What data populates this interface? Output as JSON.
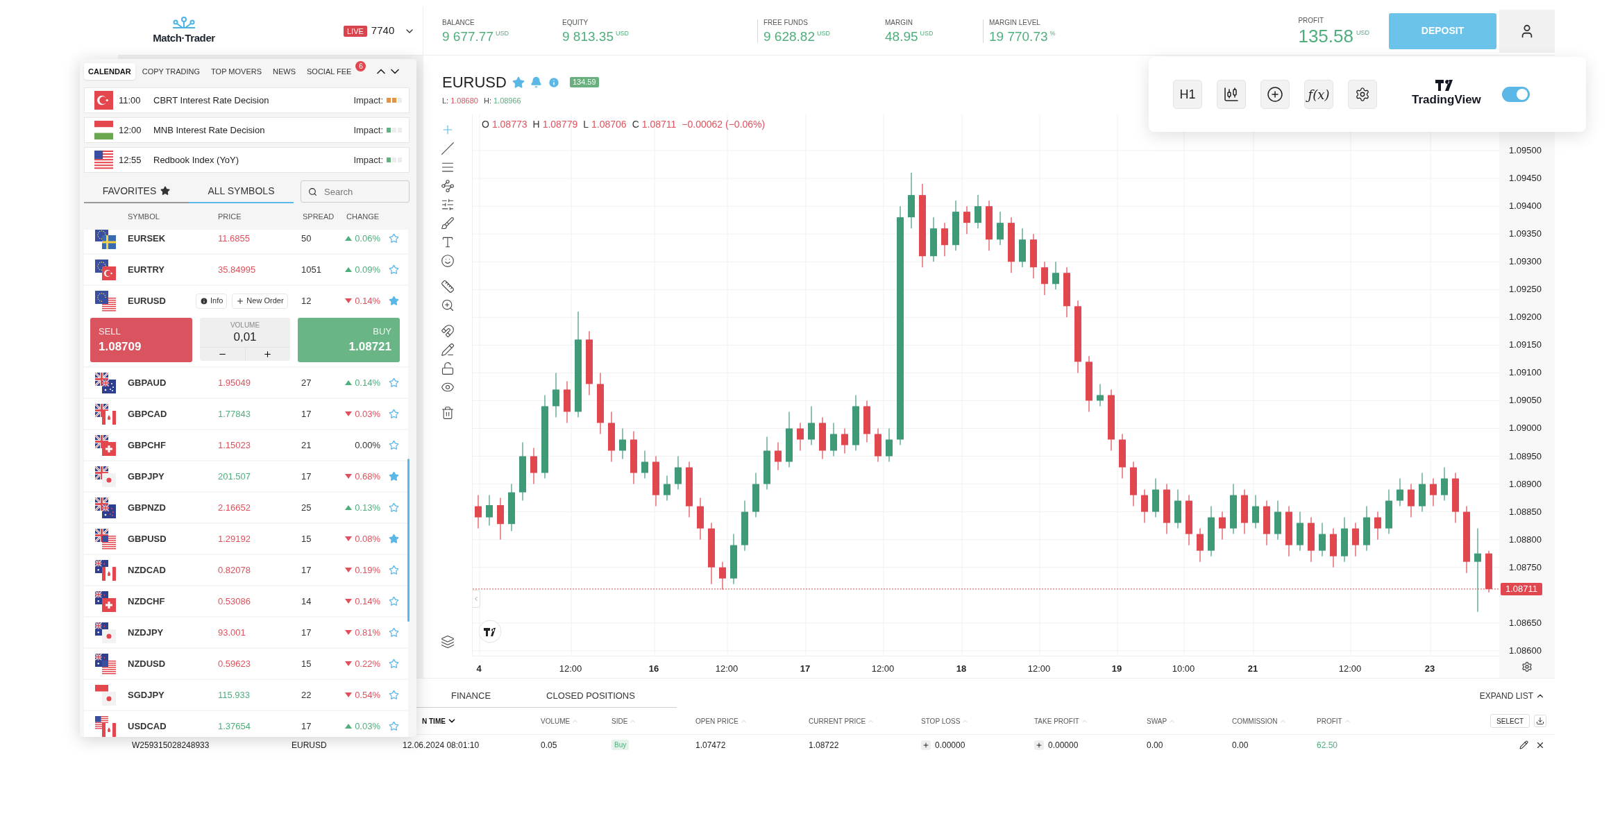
{
  "top_bar": {
    "logo_text": "Match·Trader",
    "account": {
      "badge": "LIVE",
      "number": "7740"
    },
    "stats": [
      {
        "label": "BALANCE",
        "value": "9 677.77",
        "unit": "USD"
      },
      {
        "label": "EQUITY",
        "value": "9 813.35",
        "unit": "USD"
      },
      {
        "label": "FREE FUNDS",
        "value": "9 628.82",
        "unit": "USD"
      },
      {
        "label": "MARGIN",
        "value": "48.95",
        "unit": "USD"
      },
      {
        "label": "MARGIN LEVEL",
        "value": "19 770.73",
        "unit": "%"
      }
    ],
    "profit": {
      "label": "PROFIT",
      "value": "135.58",
      "unit": "USD"
    },
    "deposit_button": "DEPOSIT"
  },
  "side_panel": {
    "tabs": [
      {
        "label": "CALENDAR",
        "selected": true
      },
      {
        "label": "COPY TRADING",
        "selected": false
      },
      {
        "label": "TOP MOVERS",
        "selected": false
      },
      {
        "label": "NEWS",
        "selected": false
      },
      {
        "label": "SOCIAL FEE",
        "selected": false,
        "badge": "6"
      }
    ],
    "events": [
      {
        "time": "11:00",
        "title": "CBRT Interest Rate Decision",
        "impact_label": "Impact:",
        "level": 0.67
      },
      {
        "time": "12:00",
        "title": "MNB Interest Rate Decision",
        "impact_label": "Impact:",
        "level": 0.33
      },
      {
        "time": "12:55",
        "title": "Redbook Index (YoY)",
        "impact_label": "Impact:",
        "level": 0.33
      }
    ],
    "symbol_tabs": [
      {
        "label": "FAVORITES",
        "selected": false
      },
      {
        "label": "ALL SYMBOLS",
        "selected": true
      }
    ],
    "search": {
      "placeholder": "Search"
    },
    "columns": [
      "SYMBOL",
      "PRICE",
      "SPREAD",
      "CHANGE"
    ],
    "rows": [
      {
        "symbol": "EURSEK",
        "price": "11.6855",
        "rising": false,
        "spread": "50",
        "change": "0.06%",
        "change_up": true,
        "change_down": false,
        "favorite": false,
        "expanded": false
      },
      {
        "symbol": "EURTRY",
        "price": "35.84995",
        "rising": false,
        "spread": "1051",
        "change": "0.09%",
        "change_up": true,
        "change_down": false,
        "favorite": false,
        "expanded": false
      },
      {
        "symbol": "EURUSD",
        "spread": "12",
        "change": "0.14%",
        "change_up": false,
        "change_down": true,
        "favorite": true,
        "expanded": true,
        "info_button": "Info",
        "new_order_button": "New Order",
        "order": {
          "sell_label": "SELL",
          "sell_price": "1.08709",
          "volume_label": "VOLUME",
          "volume": "0,01",
          "buy_label": "BUY",
          "buy_price": "1.08721"
        }
      },
      {
        "symbol": "GBPAUD",
        "price": "1.95049",
        "rising": false,
        "spread": "27",
        "change": "0.14%",
        "change_up": true,
        "change_down": false,
        "favorite": false,
        "expanded": false
      },
      {
        "symbol": "GBPCAD",
        "price": "1.77843",
        "rising": true,
        "spread": "17",
        "change": "0.03%",
        "change_up": false,
        "change_down": true,
        "favorite": false,
        "expanded": false
      },
      {
        "symbol": "GBPCHF",
        "price": "1.15023",
        "rising": false,
        "spread": "21",
        "change": "0.00%",
        "change_up": false,
        "change_down": false,
        "favorite": false,
        "expanded": false
      },
      {
        "symbol": "GBPJPY",
        "price": "201.507",
        "rising": true,
        "spread": "17",
        "change": "0.68%",
        "change_up": false,
        "change_down": true,
        "favorite": true,
        "expanded": false
      },
      {
        "symbol": "GBPNZD",
        "price": "2.16652",
        "rising": false,
        "spread": "25",
        "change": "0.13%",
        "change_up": true,
        "change_down": false,
        "favorite": false,
        "expanded": false
      },
      {
        "symbol": "GBPUSD",
        "price": "1.29192",
        "rising": false,
        "spread": "15",
        "change": "0.08%",
        "change_up": false,
        "change_down": true,
        "favorite": true,
        "expanded": false
      },
      {
        "symbol": "NZDCAD",
        "price": "0.82078",
        "rising": false,
        "spread": "17",
        "change": "0.19%",
        "change_up": false,
        "change_down": true,
        "favorite": false,
        "expanded": false
      },
      {
        "symbol": "NZDCHF",
        "price": "0.53086",
        "rising": false,
        "spread": "14",
        "change": "0.14%",
        "change_up": false,
        "change_down": true,
        "favorite": false,
        "expanded": false
      },
      {
        "symbol": "NZDJPY",
        "price": "93.001",
        "rising": false,
        "spread": "17",
        "change": "0.81%",
        "change_up": false,
        "change_down": true,
        "favorite": false,
        "expanded": false
      },
      {
        "symbol": "NZDUSD",
        "price": "0.59623",
        "rising": false,
        "spread": "15",
        "change": "0.22%",
        "change_up": false,
        "change_down": true,
        "favorite": false,
        "expanded": false
      },
      {
        "symbol": "SGDJPY",
        "price": "115.933",
        "rising": true,
        "spread": "22",
        "change": "0.54%",
        "change_up": false,
        "change_down": true,
        "favorite": false,
        "expanded": false
      },
      {
        "symbol": "USDCAD",
        "price": "1.37654",
        "rising": true,
        "spread": "17",
        "change": "0.03%",
        "change_up": true,
        "change_down": false,
        "favorite": false,
        "expanded": false
      }
    ]
  },
  "chart": {
    "symbol": "EURUSD",
    "badge": "134.59",
    "low_label": "L:",
    "low": "1.08680",
    "high_label": "H:",
    "high": "1.08966",
    "ohlc": [
      {
        "label": "O",
        "value": "1.08773"
      },
      {
        "label": "H",
        "value": "1.08779"
      },
      {
        "label": "L",
        "value": "1.08706"
      },
      {
        "label": "C",
        "value": "1.08711"
      }
    ],
    "change": "−0.00062 (−0.06%)",
    "chart_data": {
      "type": "candlestick",
      "grid": true,
      "ref_lines": [
        {
          "axis": "y",
          "value": 1.08711,
          "color": "#e0474f"
        }
      ],
      "ylim": [
        1.08591,
        1.09565
      ],
      "yticks": [
        {
          "value": 1.095,
          "label": "1.09500"
        },
        {
          "value": 1.0945,
          "label": "1.09450"
        },
        {
          "value": 1.094,
          "label": "1.09400"
        },
        {
          "value": 1.0935,
          "label": "1.09350"
        },
        {
          "value": 1.093,
          "label": "1.09300"
        },
        {
          "value": 1.0925,
          "label": "1.09250"
        },
        {
          "value": 1.092,
          "label": "1.09200"
        },
        {
          "value": 1.0915,
          "label": "1.09150"
        },
        {
          "value": 1.091,
          "label": "1.09100"
        },
        {
          "value": 1.0905,
          "label": "1.09050"
        },
        {
          "value": 1.09,
          "label": "1.09000"
        },
        {
          "value": 1.0895,
          "label": "1.08950"
        },
        {
          "value": 1.089,
          "label": "1.08900"
        },
        {
          "value": 1.0885,
          "label": "1.08850"
        },
        {
          "value": 1.088,
          "label": "1.08800"
        },
        {
          "value": 1.0875,
          "label": "1.08750"
        },
        {
          "value": 1.0865,
          "label": "1.08650"
        },
        {
          "value": 1.086,
          "label": "1.08600"
        }
      ],
      "categories": [
        null,
        null,
        null,
        null,
        null,
        null,
        null,
        null,
        null,
        null,
        null,
        null,
        null,
        null,
        null,
        null,
        null,
        null,
        null,
        null,
        null,
        null,
        null,
        null,
        null,
        null,
        null,
        null,
        null,
        null,
        null,
        null,
        null,
        null,
        null,
        null,
        null,
        null,
        null,
        null,
        null,
        null,
        null,
        null,
        null,
        null,
        null,
        null,
        null,
        null,
        null,
        null,
        null,
        null,
        null,
        null,
        null,
        null,
        null,
        null,
        null,
        null,
        null,
        null,
        null,
        null,
        null,
        null,
        null,
        null,
        null,
        null,
        null,
        null,
        null,
        null,
        null,
        null,
        null,
        null,
        null,
        null,
        null,
        null,
        null,
        null,
        null,
        null,
        null,
        null,
        null,
        null
      ],
      "ohlc": [
        [
          1.0886,
          1.0888,
          1.0882,
          1.0884
        ],
        [
          1.0884,
          1.0888,
          1.08825,
          1.08862
        ],
        [
          1.08862,
          1.08875,
          1.088,
          1.08828
        ],
        [
          1.08828,
          1.089,
          1.08815,
          1.08885
        ],
        [
          1.08885,
          1.08975,
          1.0887,
          1.0895
        ],
        [
          1.0895,
          1.08965,
          1.089,
          1.0892
        ],
        [
          1.0892,
          1.0906,
          1.0891,
          1.0904
        ],
        [
          1.0904,
          1.091,
          1.0902,
          1.0907
        ],
        [
          1.0907,
          1.09085,
          1.0901,
          1.0903
        ],
        [
          1.0903,
          1.0921,
          1.0902,
          1.0916
        ],
        [
          1.0916,
          1.09175,
          1.0906,
          1.0908
        ],
        [
          1.0908,
          1.091,
          1.0899,
          1.0901
        ],
        [
          1.0901,
          1.0903,
          1.0894,
          1.0896
        ],
        [
          1.0896,
          1.09,
          1.08945,
          1.0898
        ],
        [
          1.0898,
          1.08995,
          1.089,
          1.0892
        ],
        [
          1.0892,
          1.0896,
          1.0891,
          1.0894
        ],
        [
          1.0894,
          1.0895,
          1.0886,
          1.0888
        ],
        [
          1.0888,
          1.08915,
          1.0887,
          1.089
        ],
        [
          1.089,
          1.0895,
          1.0889,
          1.0893
        ],
        [
          1.0893,
          1.0894,
          1.0884,
          1.0886
        ],
        [
          1.0886,
          1.08875,
          1.088,
          1.0882
        ],
        [
          1.0882,
          1.0883,
          1.0872,
          1.0875
        ],
        [
          1.0875,
          1.0876,
          1.0871,
          1.0873
        ],
        [
          1.0873,
          1.0881,
          1.0872,
          1.0879
        ],
        [
          1.0879,
          1.0887,
          1.0878,
          1.0885
        ],
        [
          1.0885,
          1.0892,
          1.0884,
          1.089
        ],
        [
          1.089,
          1.08985,
          1.0889,
          1.0896
        ],
        [
          1.0896,
          1.08975,
          1.08925,
          1.0894
        ],
        [
          1.0894,
          1.0903,
          1.0893,
          1.09
        ],
        [
          1.09,
          1.0901,
          1.0896,
          1.0898
        ],
        [
          1.0898,
          1.0904,
          1.0897,
          1.0901
        ],
        [
          1.0901,
          1.0902,
          1.08945,
          1.0896
        ],
        [
          1.0896,
          1.0901,
          1.0895,
          1.0899
        ],
        [
          1.0899,
          1.09,
          1.08955,
          1.0897
        ],
        [
          1.0897,
          1.0906,
          1.0896,
          1.0904
        ],
        [
          1.0904,
          1.0905,
          1.08975,
          1.0899
        ],
        [
          1.0899,
          1.09,
          1.0894,
          1.0895
        ],
        [
          1.0895,
          1.09,
          1.0894,
          1.0898
        ],
        [
          1.0898,
          1.094,
          1.0897,
          1.0938
        ],
        [
          1.0938,
          1.0946,
          1.0936,
          1.0942
        ],
        [
          1.0942,
          1.0944,
          1.0929,
          1.0931
        ],
        [
          1.0931,
          1.0938,
          1.093,
          1.0936
        ],
        [
          1.0936,
          1.0937,
          1.0931,
          1.0933
        ],
        [
          1.0933,
          1.0941,
          1.0932,
          1.0939
        ],
        [
          1.0939,
          1.094,
          1.0935,
          1.0937
        ],
        [
          1.0937,
          1.0942,
          1.0936,
          1.094
        ],
        [
          1.094,
          1.0941,
          1.0932,
          1.0934
        ],
        [
          1.0934,
          1.0939,
          1.0933,
          1.0937
        ],
        [
          1.0937,
          1.0938,
          1.0928,
          1.093
        ],
        [
          1.093,
          1.0936,
          1.0929,
          1.0934
        ],
        [
          1.0934,
          1.0935,
          1.0927,
          1.0929
        ],
        [
          1.0929,
          1.093,
          1.0924,
          1.0926
        ],
        [
          1.0926,
          1.093,
          1.0925,
          1.0928
        ],
        [
          1.0928,
          1.0929,
          1.092,
          1.0922
        ],
        [
          1.0922,
          1.0923,
          1.091,
          1.0912
        ],
        [
          1.0912,
          1.0913,
          1.0903,
          1.0905
        ],
        [
          1.0905,
          1.0908,
          1.0904,
          1.0906
        ],
        [
          1.0906,
          1.0907,
          1.0896,
          1.0898
        ],
        [
          1.0898,
          1.0899,
          1.0891,
          1.0893
        ],
        [
          1.0893,
          1.0894,
          1.0886,
          1.0888
        ],
        [
          1.0888,
          1.0889,
          1.0883,
          1.0885
        ],
        [
          1.0885,
          1.0891,
          1.0884,
          1.0889
        ],
        [
          1.0889,
          1.089,
          1.0881,
          1.0883
        ],
        [
          1.0883,
          1.0889,
          1.0882,
          1.0887
        ],
        [
          1.0887,
          1.0888,
          1.0879,
          1.0881
        ],
        [
          1.0881,
          1.0882,
          1.0876,
          1.0878
        ],
        [
          1.0878,
          1.0886,
          1.0877,
          1.0884
        ],
        [
          1.0884,
          1.0885,
          1.088,
          1.0882
        ],
        [
          1.0882,
          1.089,
          1.0881,
          1.0888
        ],
        [
          1.0888,
          1.0889,
          1.0881,
          1.0883
        ],
        [
          1.0883,
          1.0888,
          1.0882,
          1.0886
        ],
        [
          1.0886,
          1.0887,
          1.0879,
          1.0881
        ],
        [
          1.0881,
          1.0887,
          1.088,
          1.0885
        ],
        [
          1.0885,
          1.0886,
          1.0877,
          1.0879
        ],
        [
          1.0879,
          1.0885,
          1.0878,
          1.0883
        ],
        [
          1.0883,
          1.0884,
          1.0876,
          1.0878
        ],
        [
          1.0878,
          1.0883,
          1.0877,
          1.0881
        ],
        [
          1.0881,
          1.0882,
          1.0875,
          1.0877
        ],
        [
          1.0877,
          1.0884,
          1.0876,
          1.0882
        ],
        [
          1.0882,
          1.0883,
          1.0877,
          1.0879
        ],
        [
          1.0879,
          1.0886,
          1.0878,
          1.0884
        ],
        [
          1.0884,
          1.0885,
          1.088,
          1.0882
        ],
        [
          1.0882,
          1.0889,
          1.0881,
          1.0887
        ],
        [
          1.0887,
          1.0891,
          1.0886,
          1.0889
        ],
        [
          1.0889,
          1.089,
          1.0884,
          1.0886
        ],
        [
          1.0886,
          1.0892,
          1.0885,
          1.089
        ],
        [
          1.089,
          1.0891,
          1.0886,
          1.0888
        ],
        [
          1.0888,
          1.0893,
          1.0887,
          1.0891
        ],
        [
          1.0891,
          1.0892,
          1.0883,
          1.0885
        ],
        [
          1.0885,
          1.0886,
          1.0874,
          1.0876
        ],
        [
          1.0876,
          1.0882,
          1.0867,
          1.08775
        ],
        [
          1.08775,
          1.0878,
          1.08705,
          1.08711
        ]
      ]
    },
    "current_price": "1.08711",
    "time_axis": [
      {
        "label": "4",
        "kind": "day"
      },
      {
        "label": "12:00",
        "kind": "time"
      },
      {
        "label": "16",
        "kind": "day"
      },
      {
        "label": "12:00",
        "kind": "time"
      },
      {
        "label": "17",
        "kind": "day"
      },
      {
        "label": "12:00",
        "kind": "time"
      },
      {
        "label": "18",
        "kind": "day"
      },
      {
        "label": "12:00",
        "kind": "time"
      },
      {
        "label": "19",
        "kind": "day"
      },
      {
        "label": "10:00",
        "kind": "time"
      },
      {
        "label": "21",
        "kind": "day"
      },
      {
        "label": "12:00",
        "kind": "time"
      },
      {
        "label": "23",
        "kind": "day"
      }
    ]
  },
  "chart_toolbar": {
    "timeframe": "H1",
    "function_label": "ƒ(x)",
    "brand": "TradingView",
    "toggle_on": true
  },
  "positions": {
    "tabs": [
      {
        "label": "FINANCE",
        "selected": false
      },
      {
        "label": "CLOSED POSITIONS",
        "selected": false
      }
    ],
    "expand_label": "EXPAND LIST",
    "columns": [
      {
        "label": "N TIME",
        "active": true
      },
      {
        "label": "VOLUME",
        "active": false
      },
      {
        "label": "SIDE",
        "active": false
      },
      {
        "label": "OPEN PRICE",
        "active": false
      },
      {
        "label": "CURRENT PRICE",
        "active": false
      },
      {
        "label": "STOP LOSS",
        "active": false
      },
      {
        "label": "TAKE PROFIT",
        "active": false
      },
      {
        "label": "SWAP",
        "active": false
      },
      {
        "label": "COMMISSION",
        "active": false
      },
      {
        "label": "PROFIT",
        "active": false
      }
    ],
    "select_button": "SELECT",
    "rows": [
      {
        "id": "W259315028248933",
        "symbol": "EURUSD",
        "time": "12.06.2024 08:01:10",
        "volume": "0.05",
        "side": "Buy",
        "open_price": "1.07472",
        "current_price": "1.08722",
        "stop_loss": "0.00000",
        "take_profit": "0.00000",
        "swap": "0.00",
        "commission": "0.00",
        "profit": "62.50"
      }
    ]
  }
}
